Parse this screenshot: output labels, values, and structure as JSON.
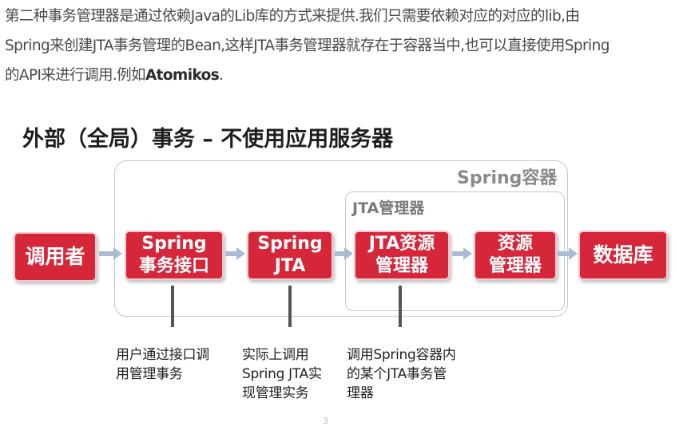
{
  "intro": {
    "line1": "第二种事务管理器是通过依赖Java的Lib库的方式来提供.我们只需要依赖对应的对应的lib,由",
    "line2": "Spring来创建JTA事务管理的Bean,这样JTA事务管理器就存在于容器当中,也可以直接使用Spring",
    "line3_prefix": "的API来进行调用.例如",
    "line3_bold": "Atomikos",
    "line3_suffix": "."
  },
  "diagram": {
    "title": "外部（全局）事务 – 不使用应用服务器",
    "outer_container_label": "Spring容器",
    "inner_container_label": "JTA管理器",
    "box_color": "#d5263a",
    "boxes": [
      {
        "line1": "调用者"
      },
      {
        "line1": "Spring",
        "line2": "事务接口"
      },
      {
        "line1": "Spring",
        "line2": "JTA"
      },
      {
        "line1": "JTA资源",
        "line2": "管理器"
      },
      {
        "line1": "资源",
        "line2": "管理器"
      },
      {
        "line1": "数据库"
      }
    ],
    "notes": [
      {
        "line1": "用户通过接口调",
        "line2": "用管理事务"
      },
      {
        "line1": "实际上调用",
        "line2": "Spring JTA实",
        "line3": "现管理实务"
      },
      {
        "line1": "调用Spring容器内",
        "line2": "的某个JTA事务管",
        "line3": "理器"
      }
    ]
  },
  "footer_mark": "3"
}
